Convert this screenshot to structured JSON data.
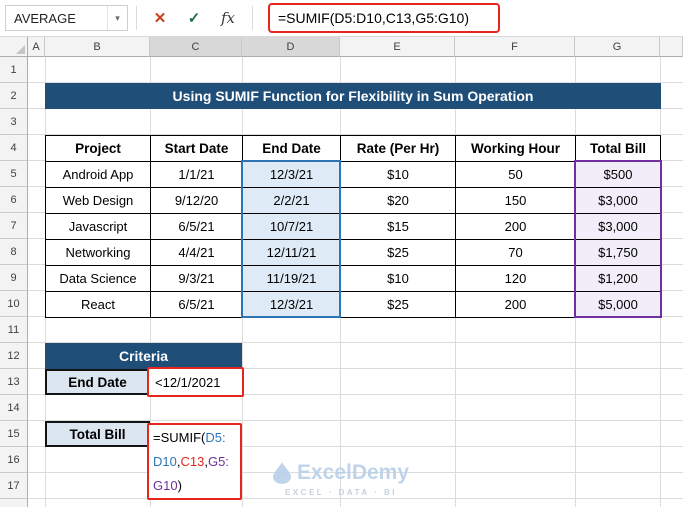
{
  "formula_bar": {
    "name_box_value": "AVERAGE",
    "formula": "=SUMIF(D5:D10,C13,G5:G10)"
  },
  "icons": {
    "dropdown": "▾",
    "cancel": "✕",
    "enter": "✓",
    "insert_function": "fx"
  },
  "sheet": {
    "columns": [
      "A",
      "B",
      "C",
      "D",
      "E",
      "F",
      "G"
    ],
    "rows": [
      "1",
      "2",
      "3",
      "4",
      "5",
      "6",
      "7",
      "8",
      "9",
      "10",
      "11",
      "12",
      "13",
      "14",
      "15",
      "16",
      "17"
    ]
  },
  "title_banner": "Using SUMIF Function for Flexibility in Sum Operation",
  "project_table": {
    "headers": [
      "Project",
      "Start Date",
      "End Date",
      "Rate (Per Hr)",
      "Working Hour",
      "Total Bill"
    ],
    "rows": [
      [
        "Android App",
        "1/1/21",
        "12/3/21",
        "$10",
        "50",
        "$500"
      ],
      [
        "Web Design",
        "9/12/20",
        "2/2/21",
        "$20",
        "150",
        "$3,000"
      ],
      [
        "Javascript",
        "6/5/21",
        "10/7/21",
        "$15",
        "200",
        "$3,000"
      ],
      [
        "Networking",
        "4/4/21",
        "12/11/21",
        "$25",
        "70",
        "$1,750"
      ],
      [
        "Data Science",
        "9/3/21",
        "11/19/21",
        "$10",
        "120",
        "$1,200"
      ],
      [
        "React",
        "6/5/21",
        "12/3/21",
        "$25",
        "200",
        "$5,000"
      ]
    ]
  },
  "criteria": {
    "header": "Criteria",
    "label": "End Date",
    "value": "<12/1/2021"
  },
  "total_bill": {
    "label": "Total Bill",
    "lines": [
      [
        {
          "text": "=SUMIF(",
          "style": "color:#000000"
        },
        {
          "text": "D5:",
          "style": "color:#2E75B6"
        }
      ],
      [
        {
          "text": "D10",
          "style": "color:#2E75B6"
        },
        {
          "text": ",",
          "style": "color:#000000"
        },
        {
          "text": "C13",
          "style": "color:#E0261C"
        },
        {
          "text": ",",
          "style": "color:#000000"
        },
        {
          "text": "G5:",
          "style": "color:#7030A0"
        }
      ],
      [
        {
          "text": "G10",
          "style": "color:#7030A0"
        },
        {
          "text": ")",
          "style": "color:#000000"
        }
      ]
    ]
  },
  "watermark": {
    "name": "ExcelDemy",
    "tagline": "EXCEL · DATA · BI"
  },
  "colors": {
    "banner_blue": "#1F4E79",
    "highlight_blue_fill": "#DEEBF7",
    "highlight_blue_border": "#2E75B6",
    "highlight_purple_fill": "#F2EEF9",
    "highlight_purple_border": "#7030A0",
    "annotation_red": "#E8251C",
    "label_fill": "#DCE6F1"
  }
}
